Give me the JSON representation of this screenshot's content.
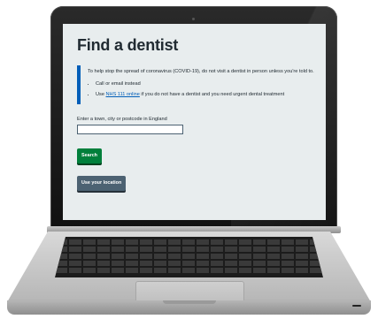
{
  "page": {
    "title": "Find a dentist",
    "notice": {
      "intro": "To help stop the spread of coronavirus (COVID-19), do not visit a dentist in person unless you're told to.",
      "bullets": [
        {
          "text": "Call or email instead"
        },
        {
          "prefix": "Use ",
          "link": "NHS 111 online",
          "suffix": " if you do not have a dentist and you need urgent dental treatment"
        }
      ]
    },
    "search": {
      "label": "Enter a town, city or postcode in England",
      "value": "",
      "placeholder": ""
    },
    "buttons": {
      "search": "Search",
      "use_location": "Use your location"
    }
  },
  "colors": {
    "inset_border": "#005eb8",
    "search_button": "#007f3b",
    "location_button": "#4c6272",
    "page_background": "#e8edee"
  }
}
